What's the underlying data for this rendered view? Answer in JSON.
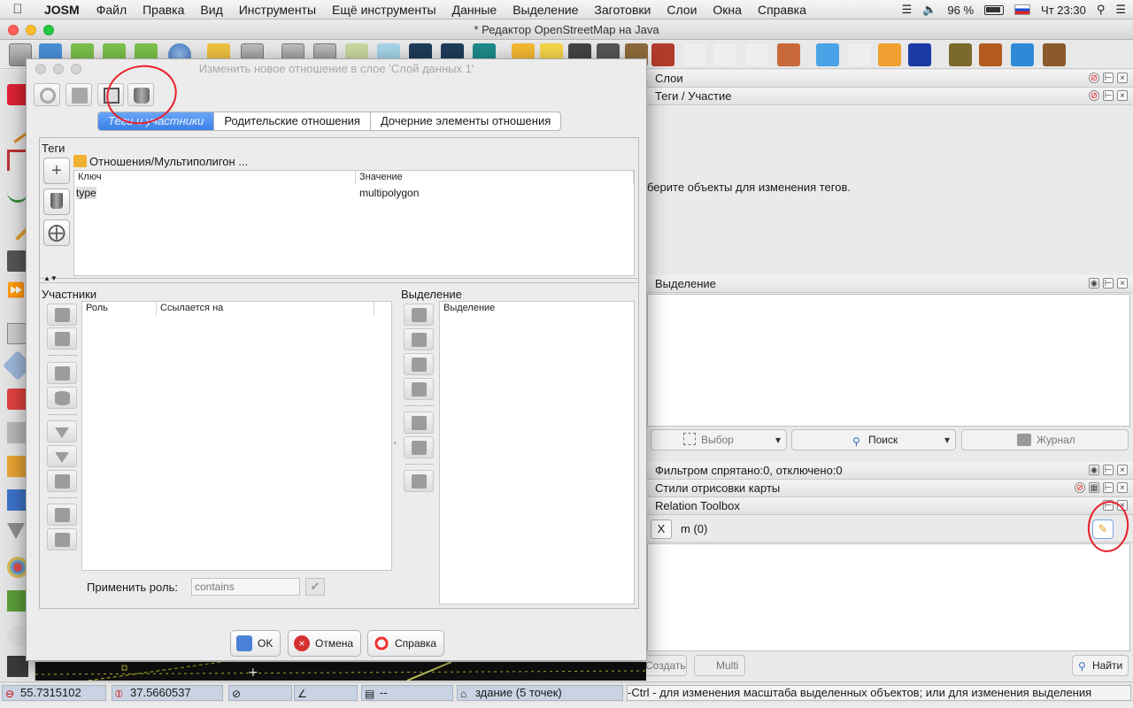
{
  "menubar": {
    "app_name": "JOSM",
    "items": [
      "Файл",
      "Правка",
      "Вид",
      "Инструменты",
      "Ещё инструменты",
      "Данные",
      "Выделение",
      "Заготовки",
      "Слои",
      "Окна",
      "Справка"
    ],
    "battery": "96 %",
    "clock": "Чт 23:30"
  },
  "window": {
    "title": "* Редактор OpenStreetMap на Java"
  },
  "panels": {
    "layers": {
      "title": "Слои"
    },
    "tags": {
      "title": "Теги / Участие",
      "hint": "берите объекты для изменения тегов."
    },
    "selection": {
      "title": "Выделение"
    },
    "select_buttons": {
      "select": "Выбор",
      "search": "Поиск",
      "history": "Журнал"
    },
    "filter": {
      "title": "Фильтром спрятано:0, отключено:0"
    },
    "styles": {
      "title": "Стили отрисовки карты"
    },
    "toolbox": {
      "title": "Relation Toolbox",
      "x_label": "X",
      "value": "m (0)"
    },
    "bottom_buttons": {
      "create": "Создать",
      "multi": "Multi",
      "find": "Найти"
    }
  },
  "statusbar": {
    "lat": "55.7315102",
    "lon": "37.5660537",
    "dist": "--",
    "feature": "здание (5 точек)",
    "help": "-Ctrl - для изменения масштаба выделенных объектов; или для изменения выделения"
  },
  "dialog": {
    "title": "Изменить новое отношение в слое 'Слой данных 1'",
    "tabs": [
      "Теги и участники",
      "Родительские отношения",
      "Дочерние элементы отношения"
    ],
    "tags_section": {
      "label": "Теги",
      "preset_name": "Отношения/Мультиполигон ...",
      "col_key": "Ключ",
      "col_value": "Значение",
      "rows": [
        {
          "key": "type",
          "value": "multipolygon"
        }
      ]
    },
    "members_section": {
      "label": "Участники",
      "col_role": "Роль",
      "col_refers": "Ссылается на",
      "apply_role_label": "Применить роль:",
      "apply_role_placeholder": "contains"
    },
    "selection_section": {
      "label": "Выделение",
      "col_selection": "Выделение"
    },
    "buttons": {
      "ok": "OK",
      "cancel": "Отмена",
      "help": "Справка"
    }
  },
  "colors": {
    "accent_tab": "#3a7fe6",
    "annotation_red": "#e8202a",
    "status_field": "#c9d3e3"
  }
}
